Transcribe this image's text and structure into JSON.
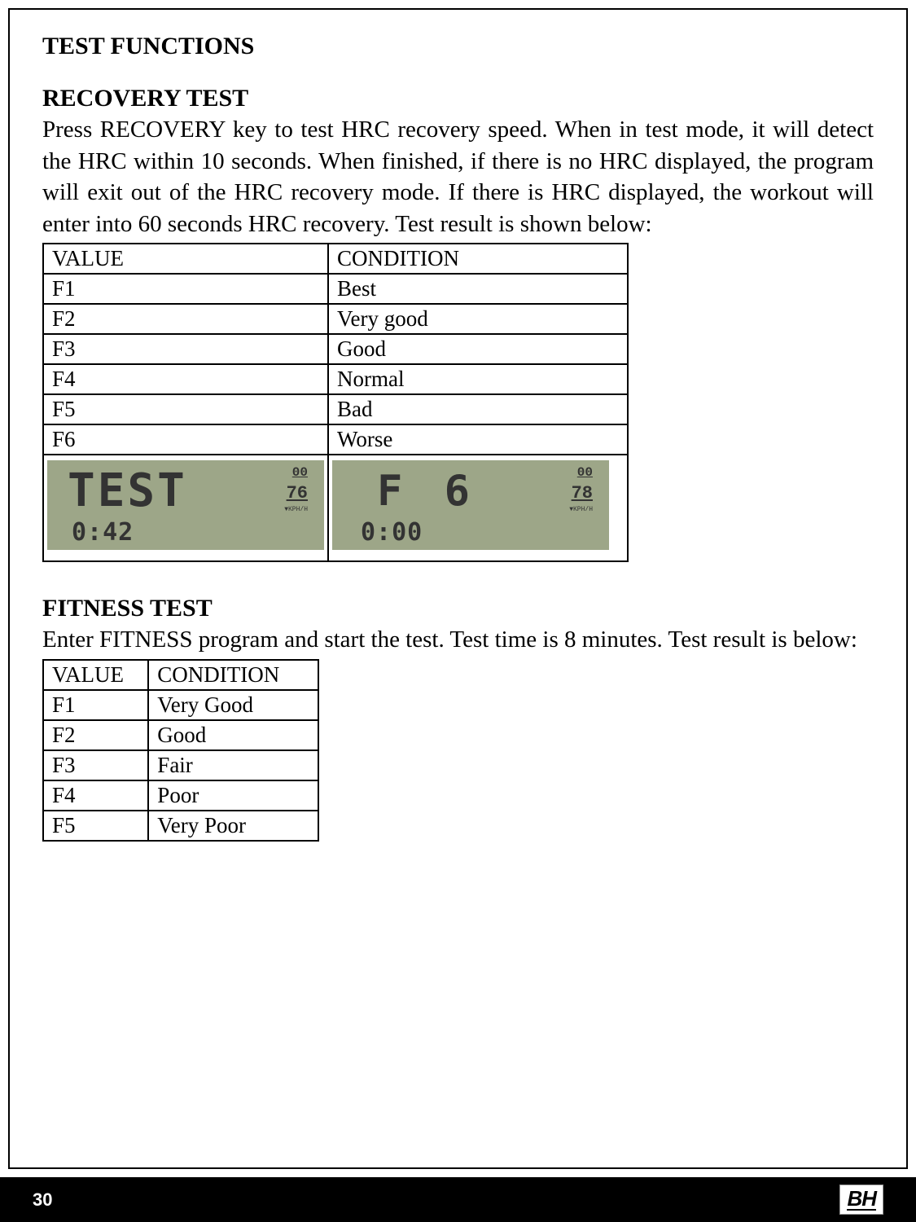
{
  "section_title": "TEST FUNCTIONS",
  "recovery": {
    "title": "RECOVERY  TEST",
    "description": "Press RECOVERY key to test HRC recovery speed. When in test mode, it will detect the HRC within 10 seconds. When finished, if there is no HRC displayed, the program will exit out of the HRC recovery mode. If there is HRC displayed, the workout will enter into 60 seconds HRC recovery. Test result is shown below:",
    "table": {
      "headers": [
        "VALUE",
        "CONDITION"
      ],
      "rows": [
        [
          "F1",
          "Best"
        ],
        [
          "F2",
          "Very good"
        ],
        [
          "F3",
          "Good"
        ],
        [
          "F4",
          "Normal"
        ],
        [
          "F5",
          "Bad"
        ],
        [
          "F6",
          "Worse"
        ]
      ]
    },
    "lcd1": {
      "main": "TEST",
      "top_right": "00",
      "mid_right": "76",
      "bottom": "0:42"
    },
    "lcd2": {
      "main": "F 6",
      "top_right": "00",
      "mid_right": "78",
      "bottom": "0:00"
    }
  },
  "fitness": {
    "title": "FITNESS  TEST",
    "description": "Enter FITNESS program and start the test. Test time is 8 minutes. Test result is below:",
    "table": {
      "headers": [
        "VALUE",
        "CONDITION"
      ],
      "rows": [
        [
          "F1",
          "Very Good"
        ],
        [
          "F2",
          "Good"
        ],
        [
          "F3",
          "Fair"
        ],
        [
          "F4",
          "Poor"
        ],
        [
          "F5",
          "Very Poor"
        ]
      ]
    }
  },
  "page_number": "30",
  "logo": "BH"
}
